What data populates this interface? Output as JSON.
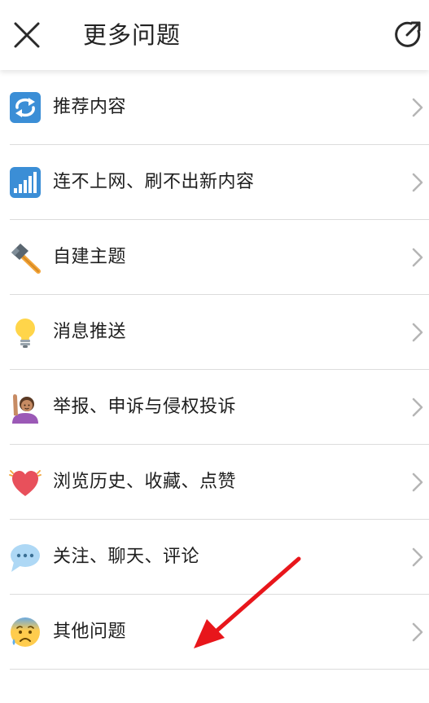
{
  "header": {
    "title": "更多问题",
    "close_icon": "close-icon",
    "share_icon": "share-external-icon"
  },
  "items": [
    {
      "label": "推荐内容",
      "icon": "refresh-icon"
    },
    {
      "label": "连不上网、刷不出新内容",
      "icon": "signal-bars-icon"
    },
    {
      "label": "自建主题",
      "icon": "hammer-icon"
    },
    {
      "label": "消息推送",
      "icon": "light-bulb-icon"
    },
    {
      "label": "举报、申诉与侵权投诉",
      "icon": "person-raising-hand-icon"
    },
    {
      "label": "浏览历史、收藏、点赞",
      "icon": "beating-heart-icon"
    },
    {
      "label": "关注、聊天、评论",
      "icon": "speech-bubble-icon"
    },
    {
      "label": "其他问题",
      "icon": "anxious-face-icon"
    }
  ],
  "colors": {
    "text": "#1e1e1e",
    "divider": "#dcdcdc",
    "chevron": "#b5b5b5",
    "accent_blue": "#3b8ed6",
    "annotation_arrow": "#e8161b"
  }
}
